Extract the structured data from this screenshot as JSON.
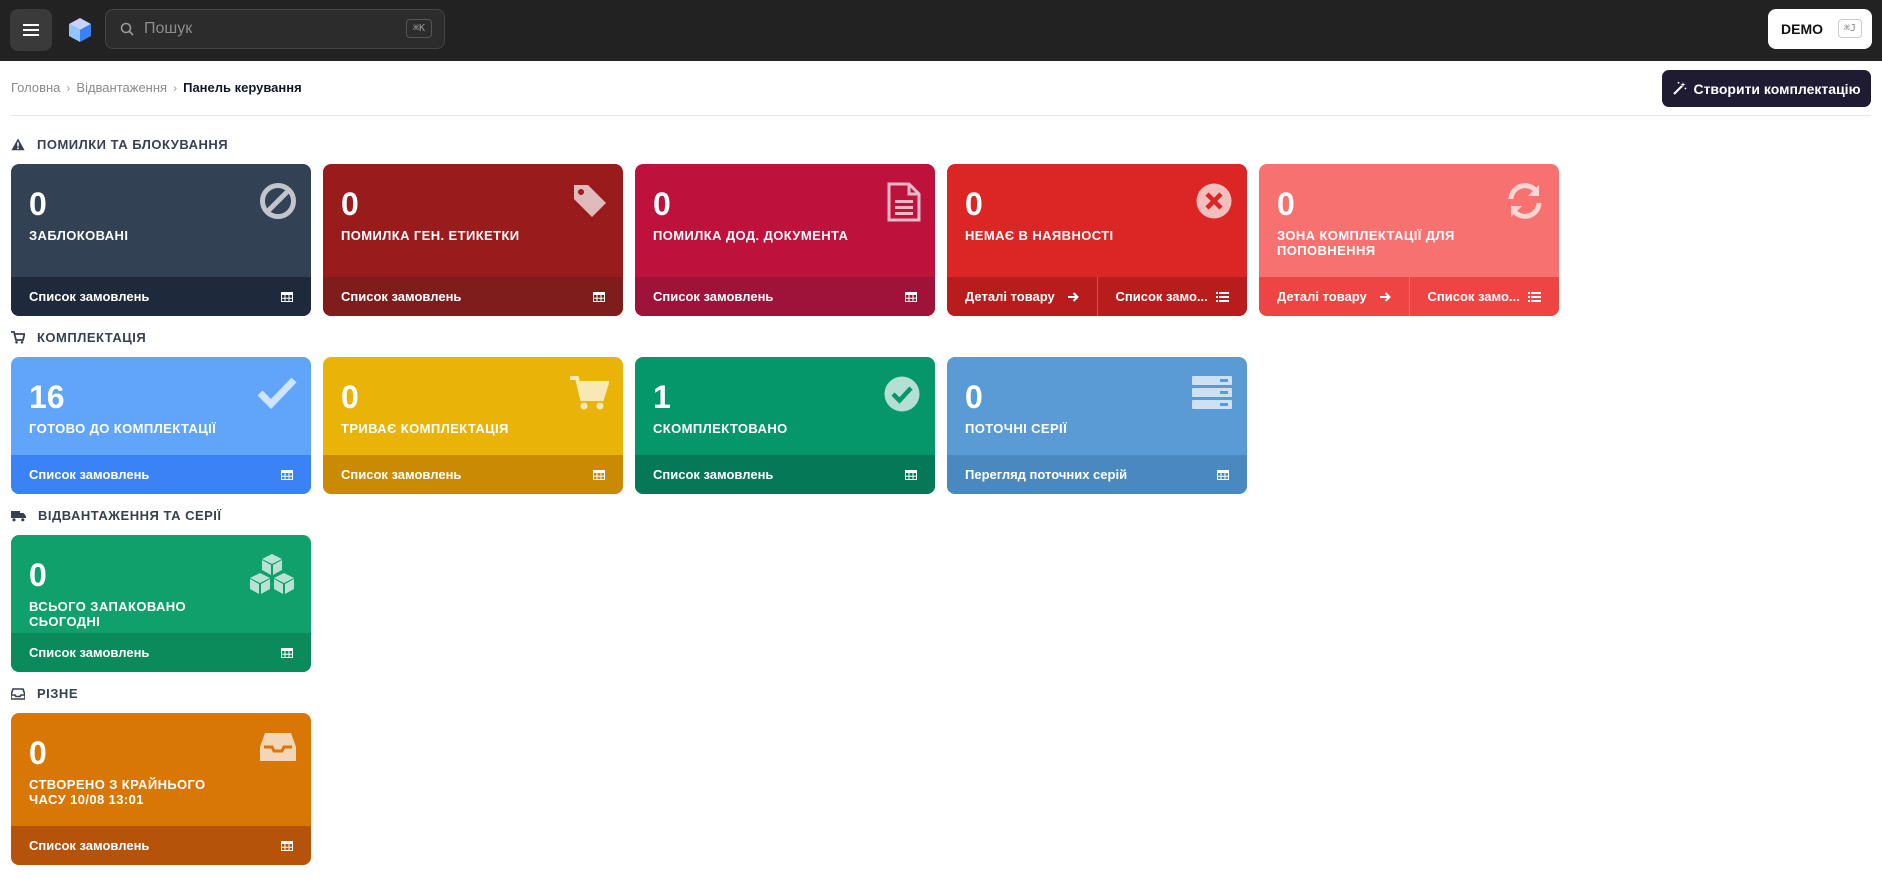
{
  "header": {
    "search_placeholder": "Пошук",
    "search_shortcut": "⌘K",
    "env_label": "DEMO",
    "env_shortcut": "⌘J"
  },
  "breadcrumb": {
    "items": [
      "Головна",
      "Відвантаження"
    ],
    "current": "Панель керування"
  },
  "toolbar": {
    "create_label": "Створити комплектацію"
  },
  "sections": [
    {
      "title": "ПОМИЛКИ ТА БЛОКУВАННЯ",
      "icon": "warning-icon",
      "cards": [
        {
          "value": "0",
          "label": "ЗАБЛОКОВАНІ",
          "icon": "ban-icon",
          "color": "#334155",
          "footer_color": "#1e293b",
          "links": [
            {
              "label": "Список замовлень",
              "icon": "table-icon"
            }
          ]
        },
        {
          "value": "0",
          "label": "ПОМИЛКА ГЕН. ЕТИКЕТКИ",
          "icon": "tag-icon",
          "color": "#991b1b",
          "footer_color": "#7f1d1d",
          "links": [
            {
              "label": "Список замовлень",
              "icon": "table-icon"
            }
          ]
        },
        {
          "value": "0",
          "label": "ПОМИЛКА ДОД. ДОКУМЕНТА",
          "icon": "document-icon",
          "color": "#be123c",
          "footer_color": "#9f1239",
          "links": [
            {
              "label": "Список замовлень",
              "icon": "table-icon"
            }
          ]
        },
        {
          "value": "0",
          "label": "НЕМАЄ В НАЯВНОСТІ",
          "icon": "x-circle-icon",
          "color": "#dc2626",
          "footer_color": "#b91c1c",
          "links": [
            {
              "label": "Деталі товару",
              "icon": "arrow-right-icon"
            },
            {
              "label": "Список замо...",
              "icon": "list-icon"
            }
          ]
        },
        {
          "value": "0",
          "label": "ЗОНА КОМПЛЕКТАЦІЇ ДЛЯ ПОПОВНЕННЯ",
          "icon": "refresh-icon",
          "color": "#f87171",
          "footer_color": "#ef4444",
          "links": [
            {
              "label": "Деталі товару",
              "icon": "arrow-right-icon"
            },
            {
              "label": "Список замо...",
              "icon": "list-icon"
            }
          ]
        }
      ]
    },
    {
      "title": "КОМПЛЕКТАЦІЯ",
      "icon": "cart-icon",
      "cards": [
        {
          "value": "16",
          "label": "ГОТОВО ДО КОМПЛЕКТАЦІЇ",
          "icon": "check-icon",
          "color": "#60a5fa",
          "footer_color": "#3b82f6",
          "links": [
            {
              "label": "Список замовлень",
              "icon": "table-icon"
            }
          ]
        },
        {
          "value": "0",
          "label": "ТРИВАЄ КОМПЛЕКТАЦІЯ",
          "icon": "cart-icon",
          "color": "#eab308",
          "footer_color": "#ca8a04",
          "links": [
            {
              "label": "Список замовлень",
              "icon": "table-icon"
            }
          ]
        },
        {
          "value": "1",
          "label": "СКОМПЛЕКТОВАНО",
          "icon": "check-circle-icon",
          "color": "#059669",
          "footer_color": "#047857",
          "links": [
            {
              "label": "Список замовлень",
              "icon": "table-icon"
            }
          ]
        },
        {
          "value": "0",
          "label": "ПОТОЧНІ СЕРІЇ",
          "icon": "server-icon",
          "color": "#5b9bd5",
          "footer_color": "#4a88c0",
          "links": [
            {
              "label": "Перегляд поточних серій",
              "icon": "table-icon"
            }
          ]
        }
      ]
    },
    {
      "title": "ВІДВАНТАЖЕННЯ ТА СЕРІЇ",
      "icon": "truck-icon",
      "cards": [
        {
          "value": "0",
          "label": "ВСЬОГО ЗАПАКОВАНО СЬОГОДНІ",
          "icon": "cubes-icon",
          "color": "#10a06b",
          "footer_color": "#0b8a5b",
          "links": [
            {
              "label": "Список замовлень",
              "icon": "table-icon"
            }
          ]
        }
      ]
    },
    {
      "title": "РІЗНЕ",
      "icon": "inbox-icon",
      "cards": [
        {
          "value": "0",
          "label": "СТВОРЕНО З КРАЙНЬОГО ЧАСУ 10/08 13:01",
          "icon": "inbox-icon",
          "color": "#d97706",
          "footer_color": "#b45309",
          "links": [
            {
              "label": "Список замовлень",
              "icon": "table-icon"
            }
          ]
        }
      ]
    }
  ]
}
